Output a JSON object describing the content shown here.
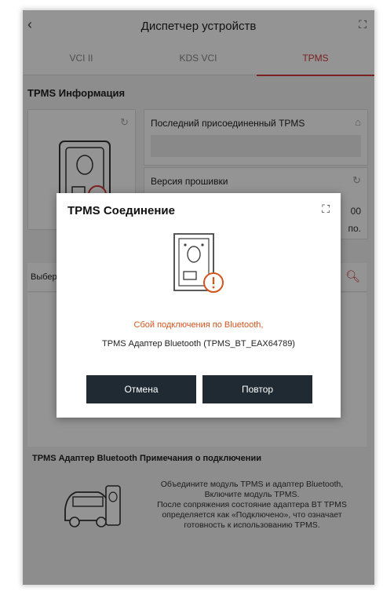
{
  "header": {
    "title": "Диспетчер устройств",
    "back_icon": "back-arrow-icon",
    "expand_icon": "expand-icon"
  },
  "tabs": [
    {
      "label": "VCI II"
    },
    {
      "label": "KDS VCI"
    },
    {
      "label": "TPMS",
      "active": true
    }
  ],
  "info": {
    "section_title": "TPMS Информация",
    "last_connected_label": "Последний присоединенный TPMS",
    "firmware_label": "Версия прошивки",
    "firmware_value_partial": "00",
    "status_partial": "по."
  },
  "select": {
    "label_partial": "Выбер"
  },
  "notes": {
    "title": "TPMS Адаптер Bluetooth Примечания о подключении",
    "lines": [
      "Объедините модуль TPMS и адаптер Bluetooth,",
      "Включите модуль TPMS.",
      "После сопряжения состояние адаптера BT TPMS",
      "определяется как «Подключено», что означает",
      "готовность к использованию TPMS."
    ]
  },
  "dialog": {
    "title": "TPMS Соединение",
    "error": "Сбой подключения по Bluetooth,",
    "adapter": "TPMS Адаптер Bluetooth (TPMS_BT_EAX64789)",
    "cancel_label": "Отмена",
    "retry_label": "Повтор"
  },
  "colors": {
    "accent": "#d43a3a",
    "error": "#d4541e",
    "button": "#1f2a33"
  }
}
